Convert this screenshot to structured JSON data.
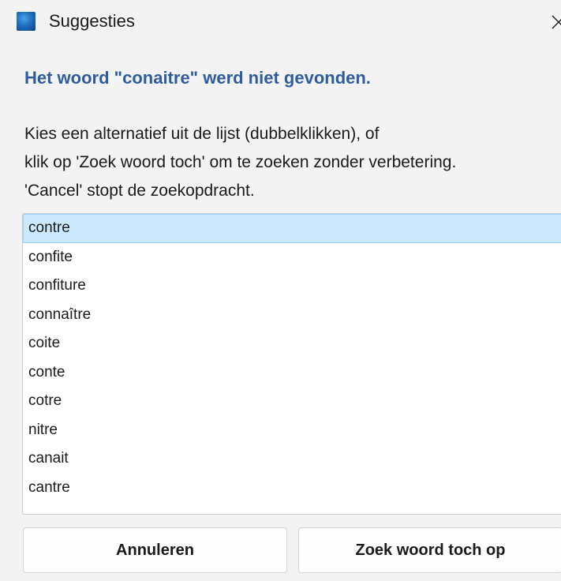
{
  "window": {
    "title": "Suggesties",
    "close_icon": "close-icon"
  },
  "dialog": {
    "heading": "Het woord \"conaitre\" werd niet gevonden.",
    "instructions": [
      "Kies een alternatief uit de lijst (dubbelklikken), of",
      "klik op 'Zoek woord toch' om te zoeken zonder verbetering.",
      "'Cancel' stopt de zoekopdracht."
    ],
    "suggestions": [
      "contre",
      "confite",
      "confiture",
      "connaître",
      "coite",
      "conte",
      "cotre",
      "nitre",
      "canait",
      "cantre"
    ],
    "selected_index": 0
  },
  "buttons": {
    "cancel_label": "Annuleren",
    "search_label": "Zoek woord toch op"
  },
  "colors": {
    "heading": "#2f5d9b",
    "selection": "#cce8ff",
    "selection_border": "#99d1ff"
  }
}
